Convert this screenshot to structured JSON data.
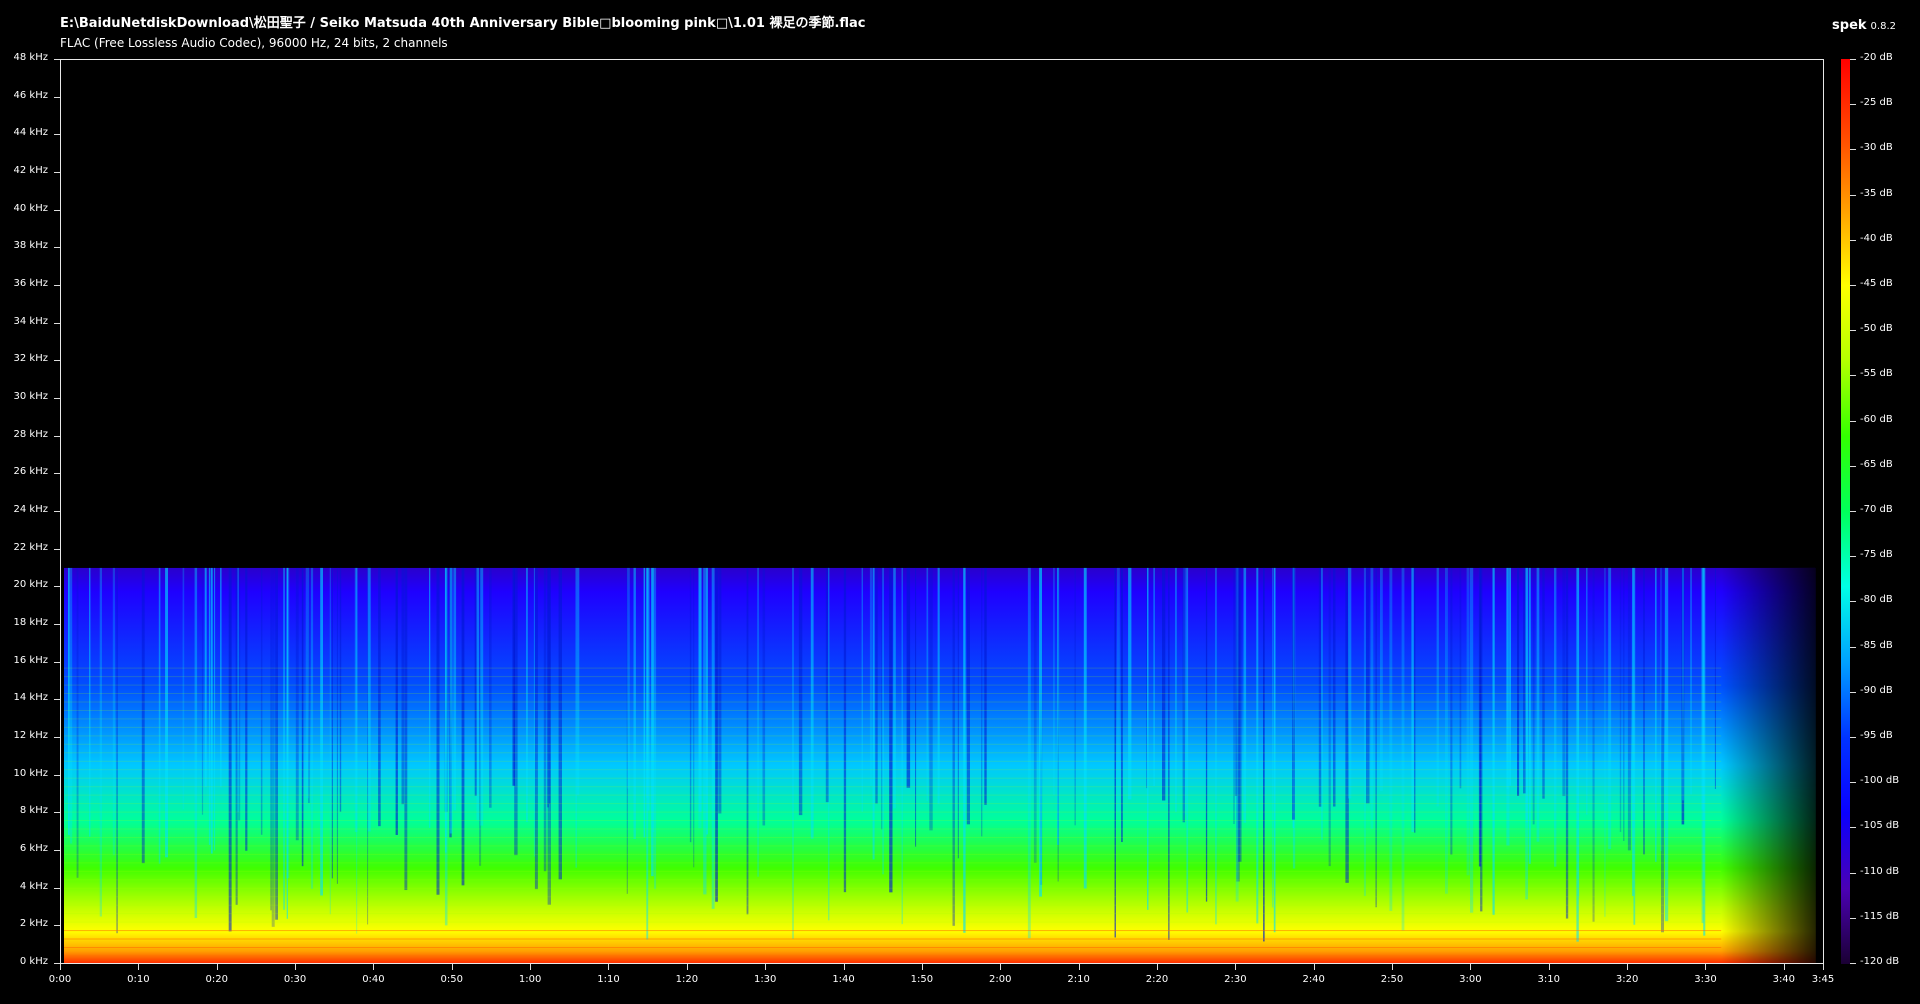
{
  "window": {
    "file_path": "E:\\BaiduNetdiskDownload\\松田聖子 / Seiko Matsuda 40th Anniversary Bible□blooming pink□\\1.01 裸足の季節.flac",
    "file_info": "FLAC (Free Lossless Audio Codec), 96000 Hz, 24 bits, 2 channels",
    "app_name": "spek",
    "app_version": "0.8.2"
  },
  "colors": {
    "background": "#000000",
    "axis_border": "#e8e8e8",
    "text": "#ffffff",
    "palette": [
      "#1a0033",
      "#4b00b4",
      "#0a00ff",
      "#0033ff",
      "#00a0ff",
      "#00ffe6",
      "#00ff5a",
      "#33ff00",
      "#b4ff00",
      "#ffff00",
      "#ffa000",
      "#ff4800",
      "#ff0000"
    ]
  },
  "chart_data": {
    "type": "heatmap",
    "title": "",
    "xlabel": "",
    "ylabel": "",
    "x_unit": "time (m:ss)",
    "y_unit": "kHz",
    "xlim": [
      "0:00",
      "3:45"
    ],
    "ylim": [
      0,
      48
    ],
    "grid": false,
    "y_ticks": [
      "0 kHz",
      "2 kHz",
      "4 kHz",
      "6 kHz",
      "8 kHz",
      "10 kHz",
      "12 kHz",
      "14 kHz",
      "16 kHz",
      "18 kHz",
      "20 kHz",
      "22 kHz",
      "24 kHz",
      "26 kHz",
      "28 kHz",
      "30 kHz",
      "32 kHz",
      "34 kHz",
      "36 kHz",
      "38 kHz",
      "40 kHz",
      "42 kHz",
      "44 kHz",
      "46 kHz",
      "48 kHz"
    ],
    "x_ticks": [
      "0:00",
      "0:10",
      "0:20",
      "0:30",
      "0:40",
      "0:50",
      "1:00",
      "1:10",
      "1:20",
      "1:30",
      "1:40",
      "1:50",
      "2:00",
      "2:10",
      "2:20",
      "2:30",
      "2:40",
      "2:50",
      "3:00",
      "3:10",
      "3:20",
      "3:30",
      "3:40",
      "3:45"
    ],
    "colorbar_ticks": [
      "-20 dB",
      "-25 dB",
      "-30 dB",
      "-35 dB",
      "-40 dB",
      "-45 dB",
      "-50 dB",
      "-55 dB",
      "-60 dB",
      "-65 dB",
      "-70 dB",
      "-75 dB",
      "-80 dB",
      "-85 dB",
      "-90 dB",
      "-95 dB",
      "-100 dB",
      "-105 dB",
      "-110 dB",
      "-115 dB",
      "-120 dB"
    ],
    "colorbar_range_db": [
      -120,
      -20
    ],
    "signal_cutoff_khz": 21,
    "duration_seconds": 225,
    "audio_end_seconds": 224
  }
}
